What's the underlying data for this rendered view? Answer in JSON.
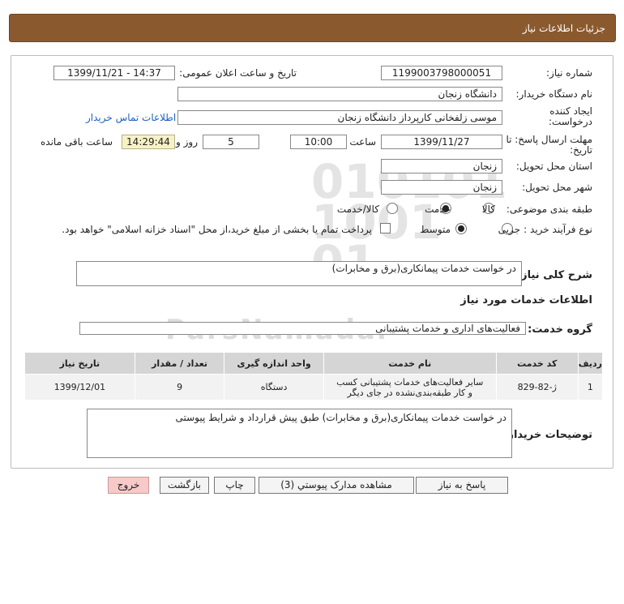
{
  "header": {
    "title": "جزئیات اطلاعات نیاز"
  },
  "fields": {
    "need_number_label": "شماره نیاز:",
    "need_number": "1199003798000051",
    "announce_label": "تاریخ و ساعت اعلان عمومی:",
    "announce_value": "1399/11/21 - 14:37",
    "buyer_label": "نام دستگاه خریدار:",
    "buyer_value": "دانشگاه زنجان",
    "creator_label": "ایجاد کننده درخواست:",
    "creator_value": "موسی  زلفخانی کارپرداز دانشگاه زنجان",
    "contact_link": "اطلاعات تماس خریدار",
    "deadline_label": "مهلت ارسال پاسخ: تا تاریخ:",
    "deadline_date": "1399/11/27",
    "time_label": "ساعت",
    "deadline_time": "10:00",
    "days_value": "5",
    "days_label": "روز و",
    "remaining_time": "14:29:44",
    "remaining_label": "ساعت باقی مانده",
    "province_label": "استان محل تحویل:",
    "province_value": "زنجان",
    "city_label": "شهر محل تحویل:",
    "city_value": "زنجان",
    "category_label": "طبقه بندی موضوعی:",
    "category_options": [
      "کالا",
      "خدمت",
      "کالا/خدمت"
    ],
    "category_selected": "خدمت",
    "process_label": "نوع فرآیند خرید :",
    "process_options": [
      "جزیی",
      "متوسط"
    ],
    "process_selected": "متوسط",
    "treasury_note": "پرداخت تمام یا بخشی از مبلغ خرید،از محل \"اسناد خزانه اسلامی\" خواهد بود.",
    "summary_label": "شرح کلی نیاز:",
    "summary_value": "در خواست خدمات پیمانکاری(برق و مخابرات)",
    "services_info_title": "اطلاعات خدمات مورد نیاز",
    "service_group_label": "گروه خدمت:",
    "service_group_value": "فعالیت‌های اداری و خدمات پشتیبانی",
    "buyer_notes_label": "توضیحات خریدار:",
    "buyer_notes_value": "در خواست خدمات پیمانکاری(برق و مخابرات) طبق پیش قرارداد و شرایط پیوستی"
  },
  "table": {
    "headers": [
      "ردیف",
      "کد خدمت",
      "نام خدمت",
      "واحد اندازه گیری",
      "تعداد / مقدار",
      "تاریخ نیاز"
    ],
    "rows": [
      [
        "1",
        "ژ-82-829",
        "سایر فعالیت‌های خدمات پشتیبانی کسب و کار طبقه‌بندی‌نشده در جای دیگر",
        "دستگاه",
        "9",
        "1399/12/01"
      ]
    ]
  },
  "buttons": {
    "reply": "پاسخ به نیاز",
    "attachments": "مشاهده مدارک پیوستي (3)",
    "print": "چاپ",
    "back": "بازگشت",
    "exit": "خروج"
  },
  "watermark": {
    "brand": "ParsNamadar",
    "phone": "۰۲۱-۸۸۳۴۹۶۷۰-۵"
  },
  "colors": {
    "header_bg": "#8a5a2e",
    "remaining_bg": "#f7f1c6",
    "exit_bg": "#f7c9c9",
    "link": "#1f5fbf"
  }
}
